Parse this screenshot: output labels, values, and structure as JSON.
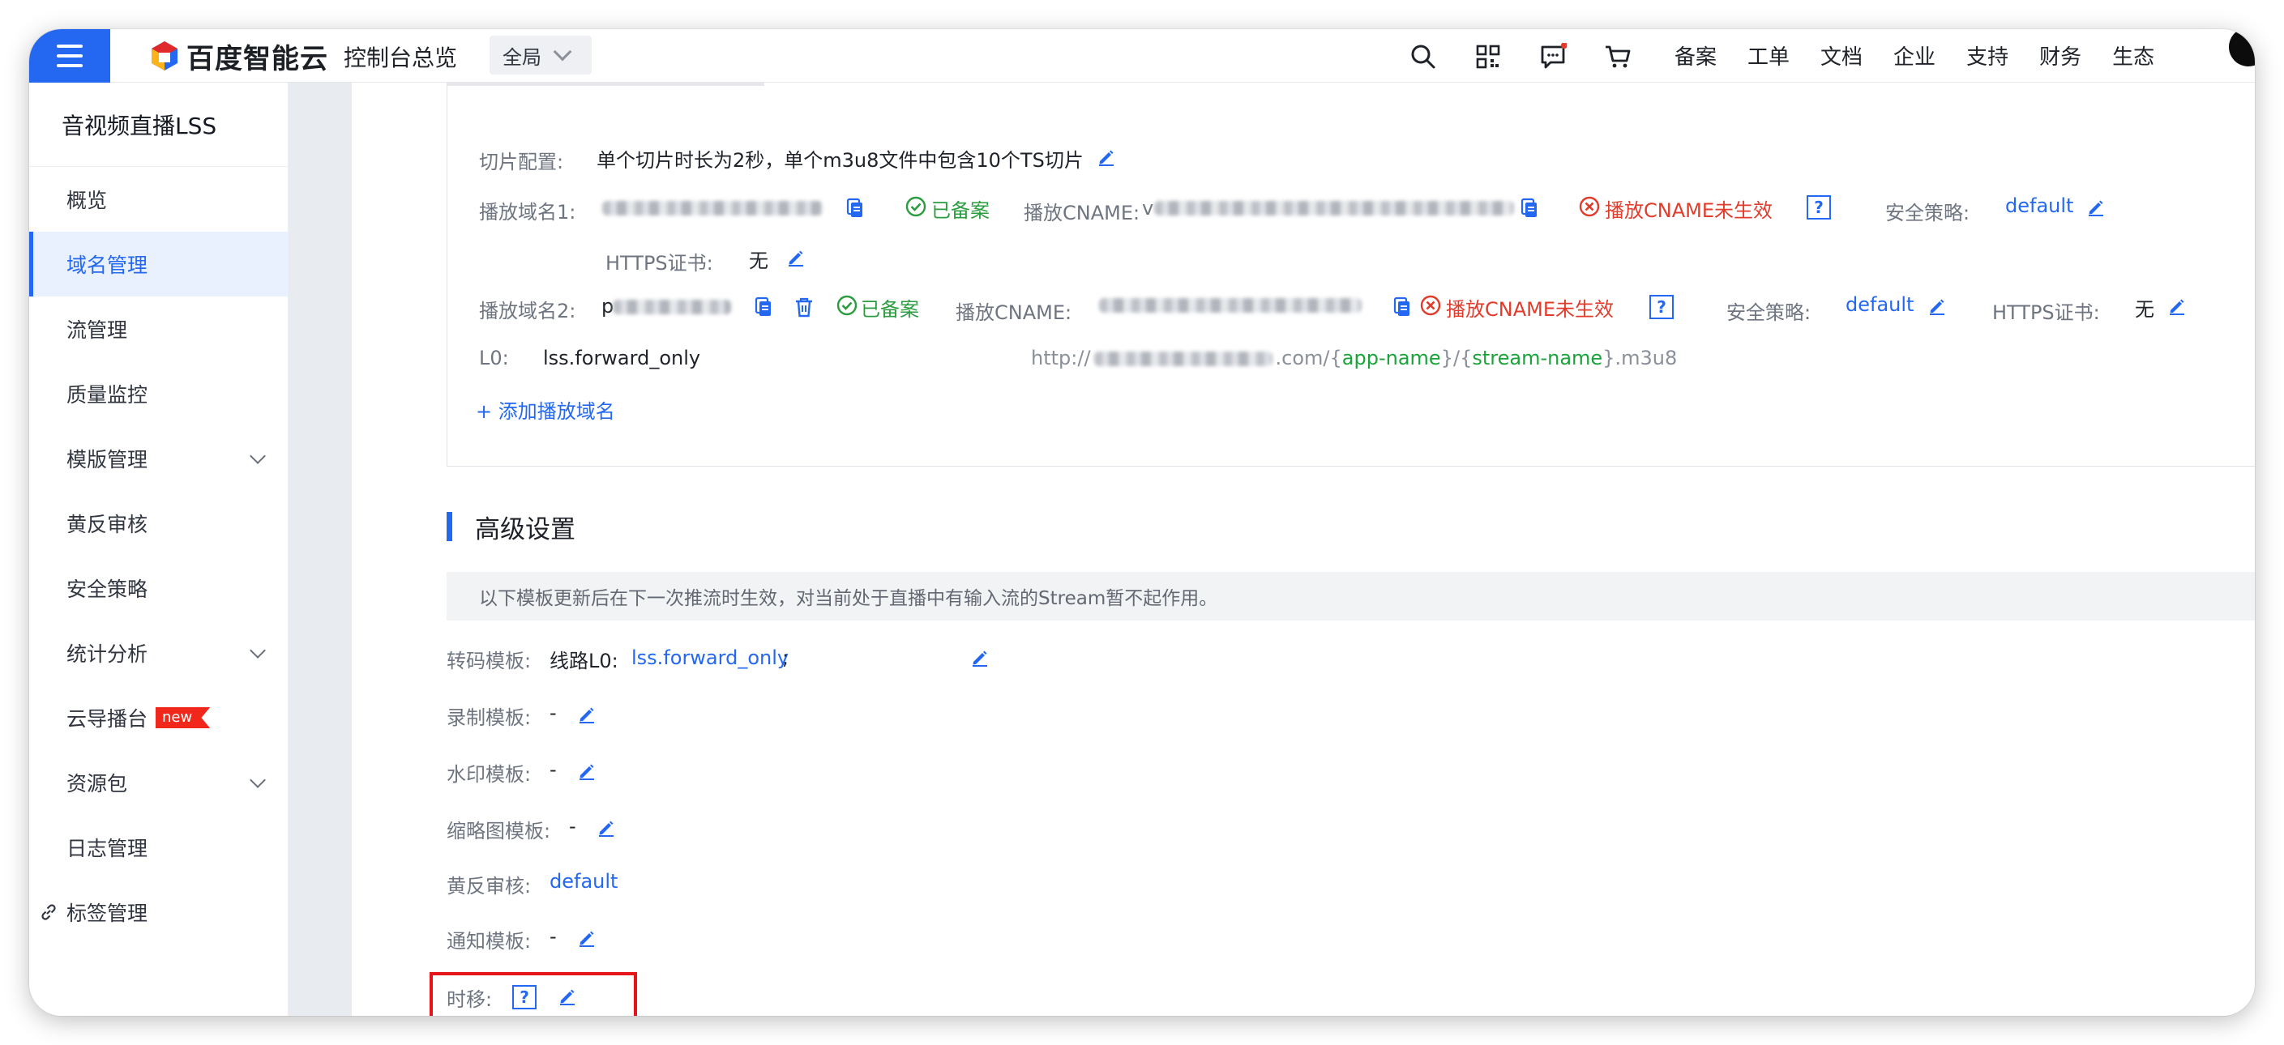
{
  "header": {
    "logo_text": "百度智能云",
    "console_home": "控制台总览",
    "region": "全局",
    "icons": [
      "search-icon",
      "qrcode-icon",
      "message-icon",
      "cart-icon"
    ],
    "nav_links": [
      "备案",
      "工单",
      "文档",
      "企业",
      "支持",
      "财务",
      "生态"
    ],
    "colors": {
      "accent": "#2468f2",
      "notify_dot": "#e13b2b"
    }
  },
  "sidebar": {
    "title": "音视频直播LSS",
    "items": [
      {
        "label": "概览",
        "active": false,
        "expandable": false
      },
      {
        "label": "域名管理",
        "active": true,
        "expandable": false
      },
      {
        "label": "流管理",
        "active": false,
        "expandable": false
      },
      {
        "label": "质量监控",
        "active": false,
        "expandable": false
      },
      {
        "label": "模版管理",
        "active": false,
        "expandable": true
      },
      {
        "label": "黄反审核",
        "active": false,
        "expandable": false
      },
      {
        "label": "安全策略",
        "active": false,
        "expandable": false
      },
      {
        "label": "统计分析",
        "active": false,
        "expandable": true
      },
      {
        "label": "云导播台",
        "active": false,
        "expandable": false,
        "badge": "new"
      },
      {
        "label": "资源包",
        "active": false,
        "expandable": true
      },
      {
        "label": "日志管理",
        "active": false,
        "expandable": false
      },
      {
        "label": "标签管理",
        "active": false,
        "expandable": false,
        "icon": "link-icon"
      }
    ]
  },
  "playback": {
    "slice_label": "切片配置:",
    "slice_value": "单个切片时长为2秒，单个m3u8文件中包含10个TS切片",
    "domain1_label": "播放域名1:",
    "domain2_label": "播放域名2:",
    "domain2_visible": "p",
    "filed_status": "已备案",
    "cname_label": "播放CNAME:",
    "cname1_prefix": "v",
    "cname_status": "播放CNAME未生效",
    "help_glyph": "?",
    "security_label": "安全策略:",
    "security_value": "default",
    "https_label": "HTTPS证书:",
    "https_value": "无",
    "l0_label": "L0:",
    "l0_value": "lss.forward_only",
    "url_prefix": "http://",
    "url_domain_suffix": ".com/",
    "url_brace_open": "{",
    "url_brace_close": "}",
    "url_slash": "/",
    "url_app": "app-name",
    "url_stream": "stream-name",
    "url_ext": ".m3u8",
    "add_domain": "+ 添加播放域名"
  },
  "advanced": {
    "title": "高级设置",
    "notice": "以下模板更新后在下一次推流时生效，对当前处于直播中有输入流的Stream暂不起作用。",
    "transcode_label": "转码模板:",
    "transcode_line": "线路L0:",
    "transcode_value": "lss.forward_only",
    "transcode_sep": ";",
    "record_label": "录制模板:",
    "record_value": "-",
    "watermark_label": "水印模板:",
    "watermark_value": "-",
    "thumbnail_label": "缩略图模板:",
    "thumbnail_value": "-",
    "review_label": "黄反审核:",
    "review_value": "default",
    "notify_label": "通知模板:",
    "notify_value": "-",
    "timeshift_label": "时移:"
  }
}
